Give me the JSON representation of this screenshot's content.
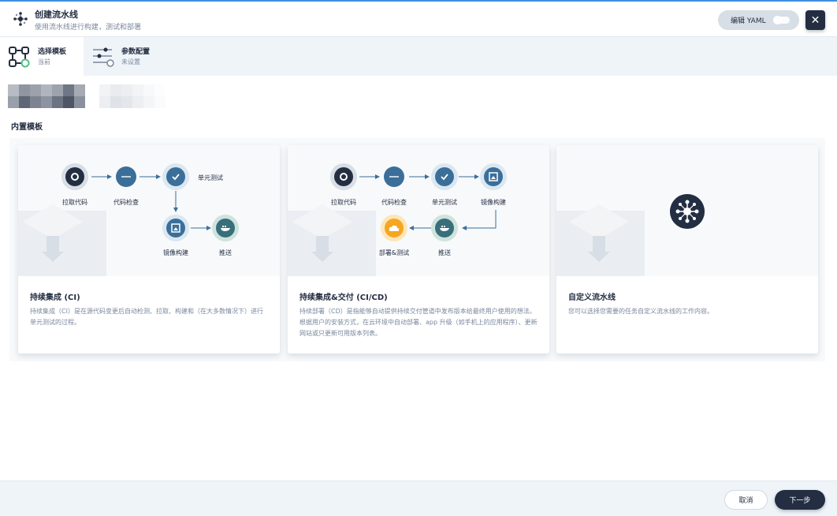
{
  "header": {
    "title": "创建流水线",
    "subtitle": "使用流水线进行构建，测试和部署",
    "icon": "pipeline-icon",
    "yaml_toggle_label": "编辑 YAML",
    "close_icon": "close-icon"
  },
  "steps": [
    {
      "title": "选择模板",
      "status": "当前",
      "icon": "template-flow-icon"
    },
    {
      "title": "参数配置",
      "status": "未设置",
      "icon": "sliders-icon"
    }
  ],
  "section_title": "内置模板",
  "cards": [
    {
      "title": "持续集成 (CI)",
      "description": "持续集成（CI）是在源代码变更后自动检测、拉取、构建和（在大多数情况下）进行单元测试的过程。",
      "stages": [
        "拉取代码",
        "代码检查",
        "单元测试",
        "镜像构建",
        "推送"
      ]
    },
    {
      "title": "持续集成&交付 (CI/CD)",
      "description": "持续部署（CD）是指能够自动提供持续交付管道中发布版本给最终用户使用的想法。根据用户的安装方式，在云环境中自动部署、app 升级（如手机上的应用程序）、更新网站或只更新可用版本列表。",
      "stages": [
        "拉取代码",
        "代码检查",
        "单元测试",
        "镜像构建",
        "推送",
        "部署&测试"
      ]
    },
    {
      "title": "自定义流水线",
      "description": "您可以选择您需要的任务自定义流水线的工作内容。",
      "stages": []
    }
  ],
  "footer": {
    "cancel_label": "取消",
    "next_label": "下一步"
  },
  "colors": {
    "accent": "#3d8fe0",
    "dark": "#242e42",
    "muted": "#79879c",
    "stage_blue": "#3b6f9a",
    "stage_teal": "#386f7b",
    "stage_orange": "#f5a623"
  }
}
